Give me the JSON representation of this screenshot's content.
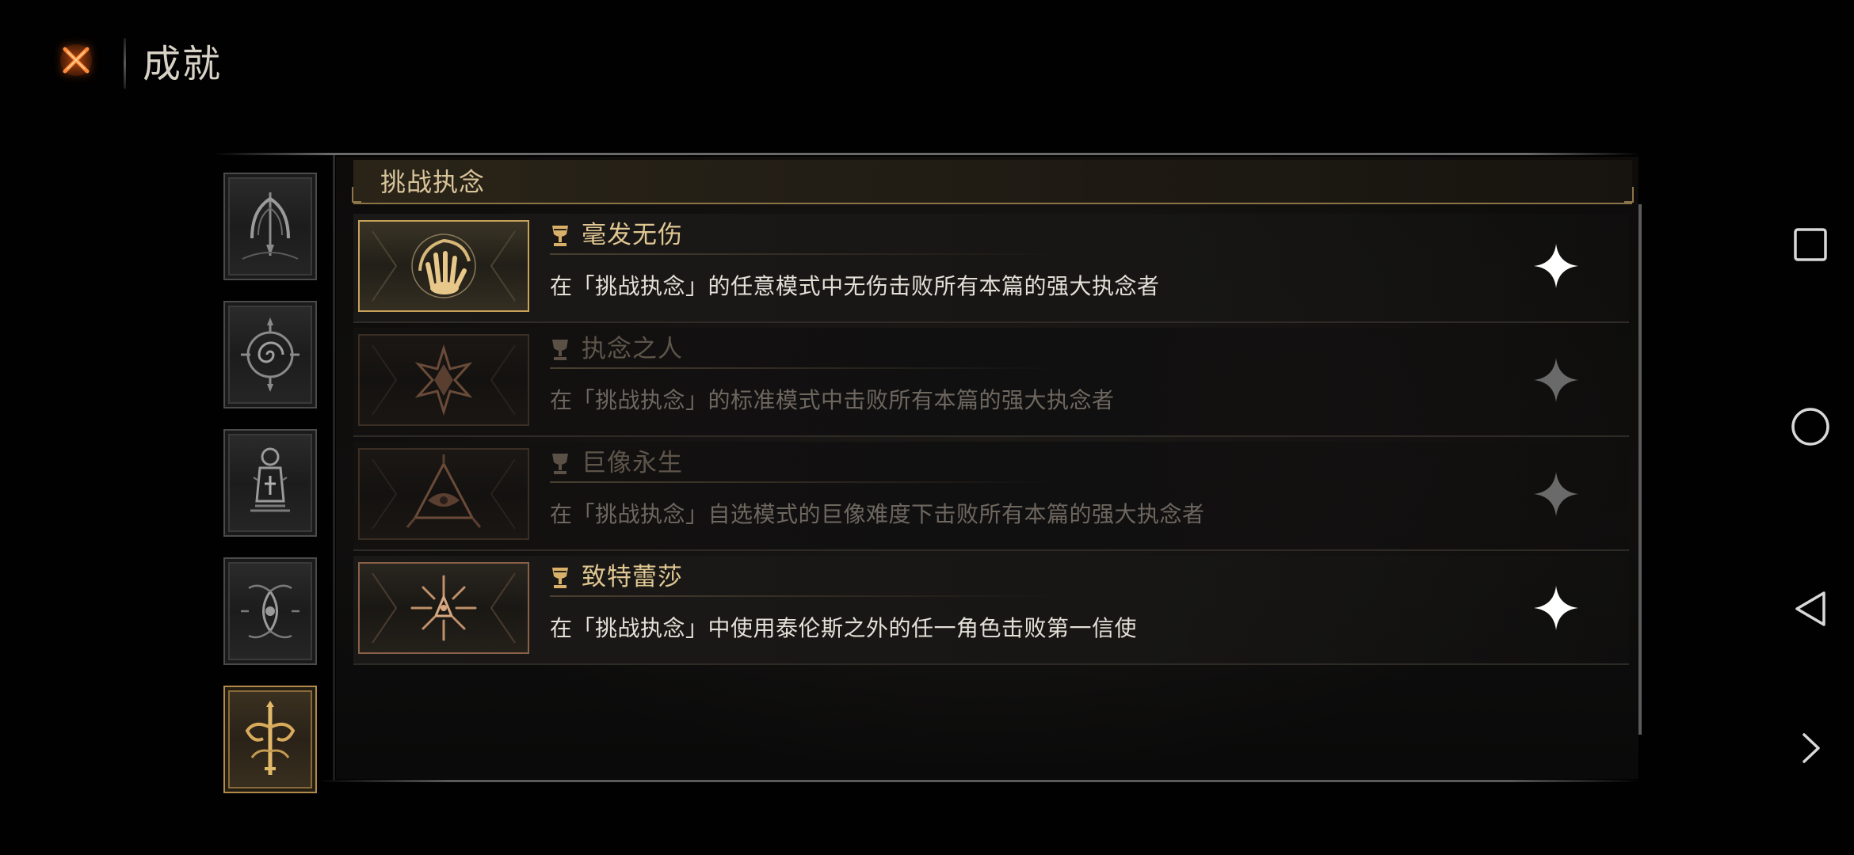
{
  "header": {
    "close_icon": "close-x-icon",
    "title": "成就"
  },
  "sidebar": {
    "tabs": [
      {
        "icon": "arch-emblem-icon",
        "active": false
      },
      {
        "icon": "spiral-compass-icon",
        "active": false
      },
      {
        "icon": "lantern-shrine-icon",
        "active": false
      },
      {
        "icon": "eye-sigil-icon",
        "active": false
      },
      {
        "icon": "sword-crest-icon",
        "active": true
      }
    ]
  },
  "section": {
    "title": "挑战执念"
  },
  "achievements": [
    {
      "name": "毫发无伤",
      "description": "在「挑战执念」的任意模式中无伤击败所有本篇的强大执念者",
      "status": "unlocked",
      "icon": "hand-swirl-icon"
    },
    {
      "name": "执念之人",
      "description": "在「挑战执念」的标准模式中击败所有本篇的强大执念者",
      "status": "locked",
      "icon": "thorn-flower-icon"
    },
    {
      "name": "巨像永生",
      "description": "在「挑战执念」自选模式的巨像难度下击败所有本篇的强大执念者",
      "status": "locked",
      "icon": "triangle-eye-icon"
    },
    {
      "name": "致特蕾莎",
      "description": "在「挑战执念」中使用泰伦斯之外的任一角色击败第一信使",
      "status": "unlocked",
      "icon": "radiant-star-icon"
    }
  ],
  "nav_bar": {
    "buttons": [
      "square-recents-icon",
      "circle-home-icon",
      "triangle-back-icon",
      "chevron-right-icon"
    ]
  },
  "colors": {
    "gold_accent": "#c9a25a",
    "title_gold": "#e0c792",
    "locked_text": "#6e6760",
    "background": "#010101"
  }
}
